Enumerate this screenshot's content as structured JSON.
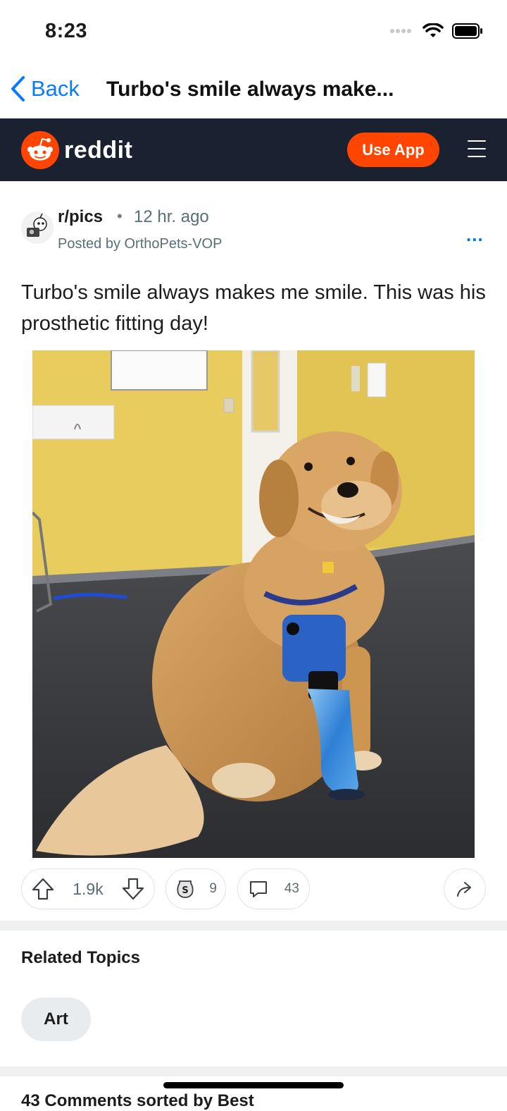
{
  "status_bar": {
    "time": "8:23"
  },
  "nav": {
    "back_label": "Back",
    "title": "Turbo's smile always make..."
  },
  "reddit_header": {
    "wordmark": "reddit",
    "use_app_label": "Use App",
    "brand_color": "#ff4500",
    "bar_color": "#1a2130"
  },
  "post": {
    "subreddit": "r/pics",
    "separator": "•",
    "age": "12 hr. ago",
    "posted_by": "Posted by OrthoPets-VOP",
    "more_label": "...",
    "title": "Turbo's smile always makes me smile. This was his prosthetic fitting day!",
    "actions": {
      "upvotes": "1.9k",
      "awards": "9",
      "comments": "43"
    }
  },
  "related": {
    "heading": "Related Topics",
    "topics": [
      "Art"
    ]
  },
  "bottom_peek": "43 Comments  sorted by  Best"
}
